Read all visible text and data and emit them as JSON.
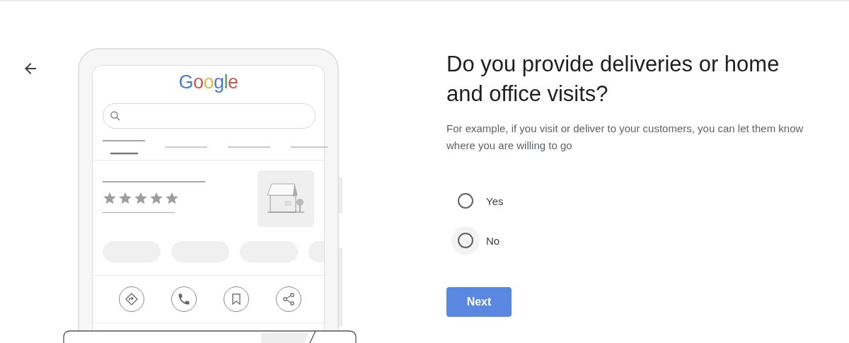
{
  "illustration": {
    "logo": "Google",
    "stars": 5
  },
  "question": {
    "title": "Do you provide deliveries or home and office visits?",
    "description": "For example, if you visit or deliver to your customers, you can let them know where you are willing to go"
  },
  "options": [
    {
      "label": "Yes",
      "selected": false,
      "focused": false
    },
    {
      "label": "No",
      "selected": false,
      "focused": true
    }
  ],
  "next_button": {
    "label": "Next"
  }
}
